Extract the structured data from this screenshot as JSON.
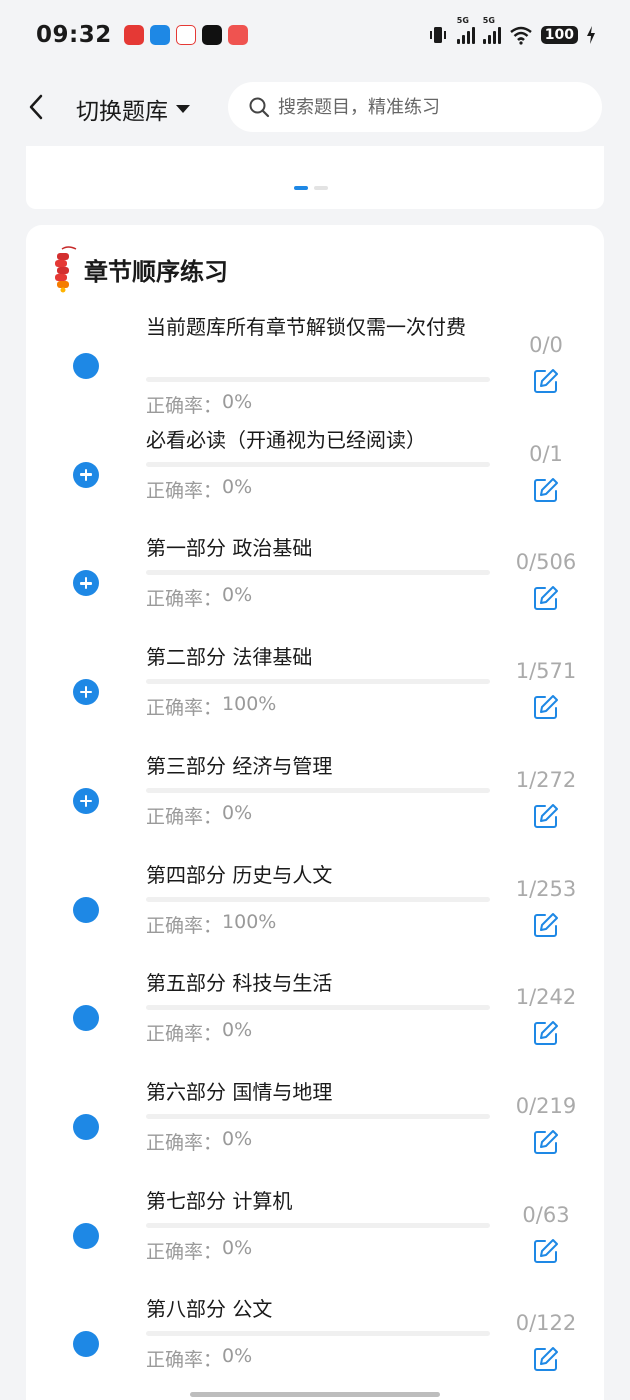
{
  "status_bar": {
    "time": "09:32",
    "signal_1": "5G",
    "signal_2": "5G",
    "battery": "100"
  },
  "header": {
    "switch_label": "切换题库",
    "search_placeholder": "搜索题目，精准练习"
  },
  "section": {
    "title": "章节顺序练习",
    "accuracy_prefix": "正确率："
  },
  "chapters": [
    {
      "name": "当前题库所有章节解锁仅需一次付费",
      "accuracy": "0%",
      "count": "0/0",
      "bullet": "dot"
    },
    {
      "name": "必看必读（开通视为已经阅读）",
      "accuracy": "0%",
      "count": "0/1",
      "bullet": "plus"
    },
    {
      "name": "第一部分 政治基础",
      "accuracy": "0%",
      "count": "0/506",
      "bullet": "plus"
    },
    {
      "name": "第二部分 法律基础",
      "accuracy": "100%",
      "count": "1/571",
      "bullet": "plus"
    },
    {
      "name": "第三部分 经济与管理",
      "accuracy": "0%",
      "count": "1/272",
      "bullet": "plus"
    },
    {
      "name": "第四部分 历史与人文",
      "accuracy": "100%",
      "count": "1/253",
      "bullet": "dot"
    },
    {
      "name": "第五部分 科技与生活",
      "accuracy": "0%",
      "count": "1/242",
      "bullet": "dot"
    },
    {
      "name": "第六部分 国情与地理",
      "accuracy": "0%",
      "count": "0/219",
      "bullet": "dot"
    },
    {
      "name": "第七部分 计算机",
      "accuracy": "0%",
      "count": "0/63",
      "bullet": "dot"
    },
    {
      "name": "第八部分 公文",
      "accuracy": "0%",
      "count": "0/122",
      "bullet": "dot"
    }
  ],
  "colors": {
    "accent": "#1e88e5",
    "background": "#f3f4f6",
    "muted_text": "#9a9a9a"
  }
}
